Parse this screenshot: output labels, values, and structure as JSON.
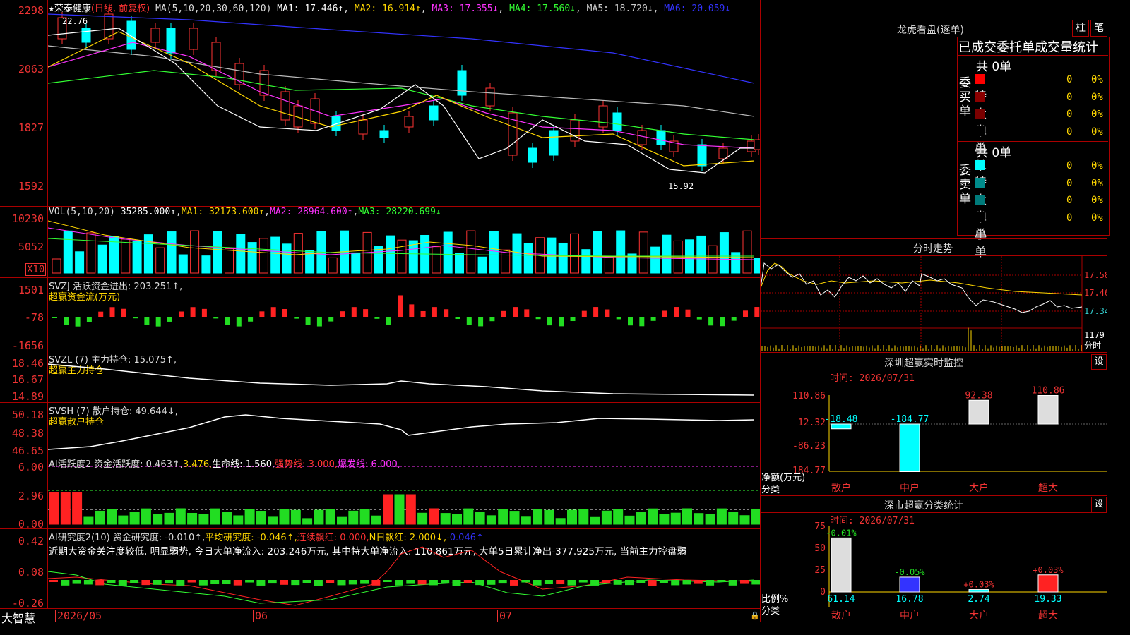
{
  "main": {
    "title_star": "★",
    "stock_name": "荣泰健康",
    "period": "(日线, 前复权)",
    "ma_label": "MA(5,10,20,30,60,120)",
    "ma": [
      {
        "name": "MA1",
        "value": "17.446↑",
        "color": "#ffffff"
      },
      {
        "name": "MA2",
        "value": "16.914↑",
        "color": "#ffd700"
      },
      {
        "name": "MA3",
        "value": "17.355↓",
        "color": "#ff33ff"
      },
      {
        "name": "MA4",
        "value": "17.560↓",
        "color": "#33ff33"
      },
      {
        "name": "MA5",
        "value": "18.720↓",
        "color": "#cccccc"
      },
      {
        "name": "MA6",
        "value": "20.059↓",
        "color": "#3333ff"
      }
    ],
    "y_ticks": [
      "2298",
      "2063",
      "1827",
      "1592"
    ],
    "high_label": "22.76",
    "low_label": "15.92"
  },
  "vol": {
    "label": "VOL(5,10,20)",
    "value": "35285.000↑",
    "ma1": "MA1: 32173.600↑",
    "ma2": "MA2: 28964.600↑",
    "ma3": "MA3: 28220.699↓",
    "y_ticks": [
      "10230",
      "5052"
    ],
    "unit": "X10"
  },
  "svzj": {
    "label": "SVZJ  活跃资金进出: 203.251↑,",
    "sub": "超赢资金流(万元)",
    "y_ticks": [
      "1501",
      "-78",
      "-1656"
    ]
  },
  "svzl": {
    "label": "SVZL (7) 主力持仓: 15.075↑,",
    "sub": "超赢主力持仓",
    "y_ticks": [
      "18.46",
      "16.67",
      "14.89"
    ]
  },
  "svsh": {
    "label": "SVSH (7) 散户持仓: 49.644↓,",
    "sub": "超赢散户持仓",
    "y_ticks": [
      "50.18",
      "48.38",
      "46.65"
    ]
  },
  "ai1": {
    "label": "AI活跃度2 资金活跃度: 0.463↑,",
    "v2": "3.476,",
    "life": "生命线: 1.560,",
    "strong": "强势线: 3.000,",
    "burst": "爆发线: 6.000,",
    "y_ticks": [
      "6.00",
      "2.96",
      "0.00"
    ]
  },
  "ai2": {
    "label": "AI研究度2(10) 资金研究度: -0.010↑,",
    "avg": "平均研究度: -0.046↑,",
    "red": "连续飘红: 0.000,",
    "nred": "N日飘红: 2.000↓,",
    "last": "-0.046↑",
    "comment": "近期大资金关注度较低, 明显弱势, 今日大单净流入: 203.246万元, 其中特大单净流入: 110.861万元, 大单5日累计净出-377.925万元, 当前主力控盘弱",
    "y_ticks": [
      "0.42",
      "0.08",
      "-0.26"
    ]
  },
  "footer": {
    "brand": "大智慧",
    "dates": [
      "2026/05",
      "06",
      "07"
    ]
  },
  "right": {
    "dragon_title": "龙虎看盘(逐单)",
    "btn_bar": "柱",
    "btn_pen": "笔",
    "stat_title": "已成交委托单成交量统计",
    "buy_label": "委买单",
    "sell_label": "委卖单",
    "buy_total": "共 0单",
    "sell_total": "共 0单",
    "buy_rows": [
      {
        "name": "特大",
        "count": "0",
        "pct": "0%",
        "color": "#ff0000"
      },
      {
        "name": "大单",
        "count": "0",
        "pct": "0%",
        "color": "#8b0000"
      },
      {
        "name": "中单",
        "count": "0",
        "pct": "0%",
        "color": "#7a0000"
      },
      {
        "name": "小单",
        "count": "0",
        "pct": "0%",
        "color": "#000000"
      }
    ],
    "sell_rows": [
      {
        "name": "特大",
        "count": "0",
        "pct": "0%",
        "color": "#00ffff"
      },
      {
        "name": "大单",
        "count": "0",
        "pct": "0%",
        "color": "#008b8b"
      },
      {
        "name": "中单",
        "count": "0",
        "pct": "0%",
        "color": "#007a7a"
      },
      {
        "name": "小单",
        "count": "0",
        "pct": "0%",
        "color": "#000000"
      }
    ],
    "intraday_title": "分时走势",
    "intraday_ticks": [
      "17.58",
      "17.46",
      "17.34"
    ],
    "intraday_vol": "1179",
    "intraday_vol_label": "分时",
    "sz_title": "深圳超赢实时监控",
    "sz_settings": "设",
    "sz_date": "时间: 2026/07/31",
    "sz_ticks": [
      "110.86",
      "12.32",
      "-86.23",
      "-184.77"
    ],
    "sz_unit": "净额(万元)",
    "sz_cat": "分类",
    "sz_bars": [
      {
        "name": "散户",
        "value": "-18.48"
      },
      {
        "name": "中户",
        "value": "-184.77"
      },
      {
        "name": "大户",
        "value": "92.38"
      },
      {
        "name": "超大",
        "value": "110.86"
      }
    ],
    "sh_title": "深市超赢分类统计",
    "sh_settings": "设",
    "sh_date": "时间: 2026/07/31",
    "sh_ticks": [
      "75",
      "50",
      "25",
      "0"
    ],
    "sh_unit": "比例%",
    "sh_cat": "分类",
    "sh_bars": [
      {
        "name": "散户",
        "value": "61.14",
        "delta": "-0.01%"
      },
      {
        "name": "中户",
        "value": "16.78",
        "delta": "-0.05%"
      },
      {
        "name": "大户",
        "value": "2.74",
        "delta": "+0.03%"
      },
      {
        "name": "超大",
        "value": "19.33",
        "delta": "+0.03%"
      }
    ]
  }
}
